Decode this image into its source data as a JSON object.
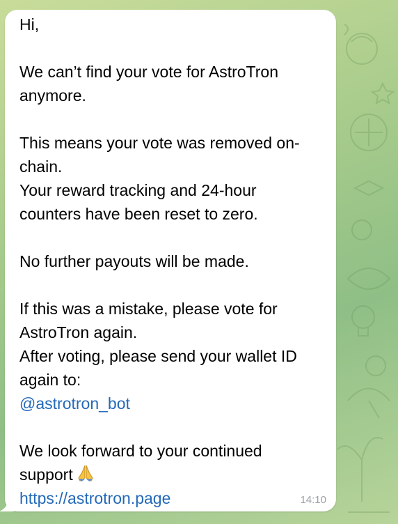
{
  "message": {
    "greeting": "Hi,",
    "para1": [
      "We can’t find your vote for AstroTron",
      "anymore."
    ],
    "para2": [
      "This means your vote was removed on-",
      "chain.",
      "Your reward tracking and 24-hour",
      "counters have been reset to zero."
    ],
    "para3": "No further payouts will be made.",
    "para4": [
      "If this was a mistake, please vote for",
      "AstroTron again.",
      "After voting, please send your wallet ID",
      "again to:"
    ],
    "bot_link": "@astrotron_bot",
    "para5": [
      "We look forward to your continued",
      "support"
    ],
    "emoji": "praying-hands-icon",
    "site_link": "https://astrotron.page",
    "time": "14:10"
  },
  "colors": {
    "link": "#2469b8",
    "bubble": "#ffffff",
    "wallpaper": "#a9cc8c"
  }
}
